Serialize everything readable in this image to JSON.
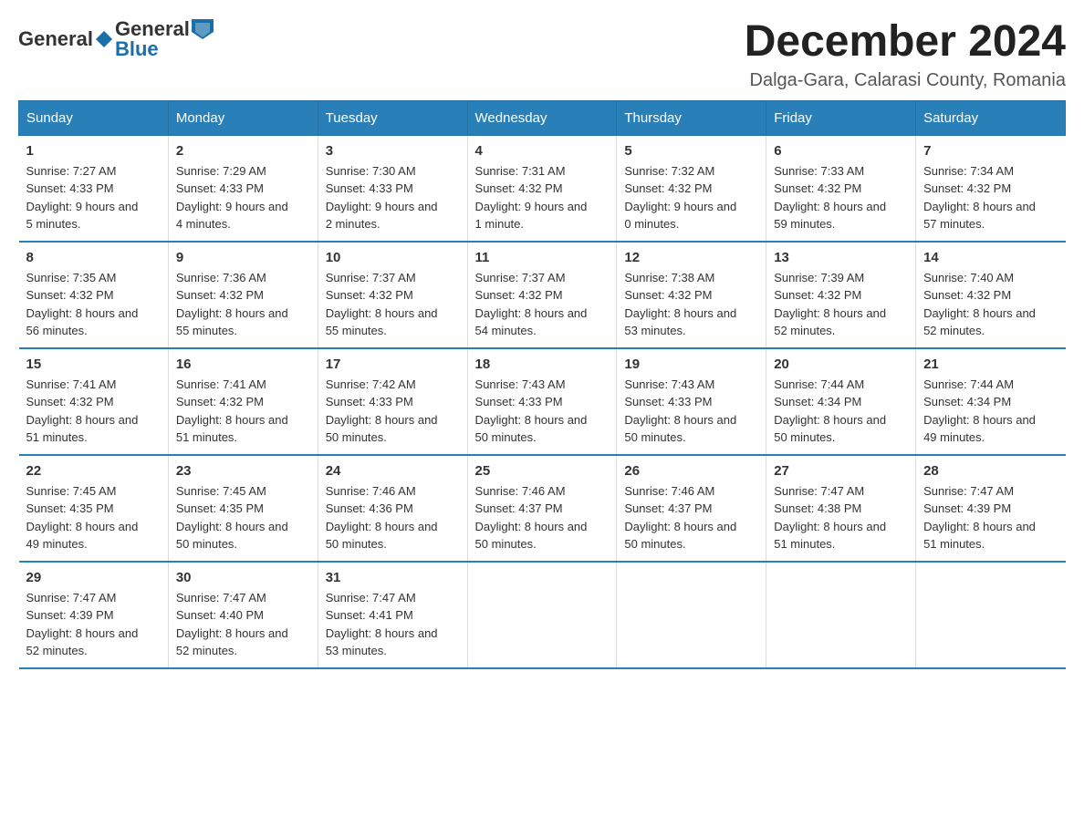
{
  "header": {
    "logo": {
      "general": "General",
      "blue": "Blue"
    },
    "title": "December 2024",
    "location": "Dalga-Gara, Calarasi County, Romania"
  },
  "days_of_week": [
    "Sunday",
    "Monday",
    "Tuesday",
    "Wednesday",
    "Thursday",
    "Friday",
    "Saturday"
  ],
  "weeks": [
    [
      {
        "day": 1,
        "sunrise": "7:27 AM",
        "sunset": "4:33 PM",
        "daylight": "9 hours and 5 minutes."
      },
      {
        "day": 2,
        "sunrise": "7:29 AM",
        "sunset": "4:33 PM",
        "daylight": "9 hours and 4 minutes."
      },
      {
        "day": 3,
        "sunrise": "7:30 AM",
        "sunset": "4:33 PM",
        "daylight": "9 hours and 2 minutes."
      },
      {
        "day": 4,
        "sunrise": "7:31 AM",
        "sunset": "4:32 PM",
        "daylight": "9 hours and 1 minute."
      },
      {
        "day": 5,
        "sunrise": "7:32 AM",
        "sunset": "4:32 PM",
        "daylight": "9 hours and 0 minutes."
      },
      {
        "day": 6,
        "sunrise": "7:33 AM",
        "sunset": "4:32 PM",
        "daylight": "8 hours and 59 minutes."
      },
      {
        "day": 7,
        "sunrise": "7:34 AM",
        "sunset": "4:32 PM",
        "daylight": "8 hours and 57 minutes."
      }
    ],
    [
      {
        "day": 8,
        "sunrise": "7:35 AM",
        "sunset": "4:32 PM",
        "daylight": "8 hours and 56 minutes."
      },
      {
        "day": 9,
        "sunrise": "7:36 AM",
        "sunset": "4:32 PM",
        "daylight": "8 hours and 55 minutes."
      },
      {
        "day": 10,
        "sunrise": "7:37 AM",
        "sunset": "4:32 PM",
        "daylight": "8 hours and 55 minutes."
      },
      {
        "day": 11,
        "sunrise": "7:37 AM",
        "sunset": "4:32 PM",
        "daylight": "8 hours and 54 minutes."
      },
      {
        "day": 12,
        "sunrise": "7:38 AM",
        "sunset": "4:32 PM",
        "daylight": "8 hours and 53 minutes."
      },
      {
        "day": 13,
        "sunrise": "7:39 AM",
        "sunset": "4:32 PM",
        "daylight": "8 hours and 52 minutes."
      },
      {
        "day": 14,
        "sunrise": "7:40 AM",
        "sunset": "4:32 PM",
        "daylight": "8 hours and 52 minutes."
      }
    ],
    [
      {
        "day": 15,
        "sunrise": "7:41 AM",
        "sunset": "4:32 PM",
        "daylight": "8 hours and 51 minutes."
      },
      {
        "day": 16,
        "sunrise": "7:41 AM",
        "sunset": "4:32 PM",
        "daylight": "8 hours and 51 minutes."
      },
      {
        "day": 17,
        "sunrise": "7:42 AM",
        "sunset": "4:33 PM",
        "daylight": "8 hours and 50 minutes."
      },
      {
        "day": 18,
        "sunrise": "7:43 AM",
        "sunset": "4:33 PM",
        "daylight": "8 hours and 50 minutes."
      },
      {
        "day": 19,
        "sunrise": "7:43 AM",
        "sunset": "4:33 PM",
        "daylight": "8 hours and 50 minutes."
      },
      {
        "day": 20,
        "sunrise": "7:44 AM",
        "sunset": "4:34 PM",
        "daylight": "8 hours and 50 minutes."
      },
      {
        "day": 21,
        "sunrise": "7:44 AM",
        "sunset": "4:34 PM",
        "daylight": "8 hours and 49 minutes."
      }
    ],
    [
      {
        "day": 22,
        "sunrise": "7:45 AM",
        "sunset": "4:35 PM",
        "daylight": "8 hours and 49 minutes."
      },
      {
        "day": 23,
        "sunrise": "7:45 AM",
        "sunset": "4:35 PM",
        "daylight": "8 hours and 50 minutes."
      },
      {
        "day": 24,
        "sunrise": "7:46 AM",
        "sunset": "4:36 PM",
        "daylight": "8 hours and 50 minutes."
      },
      {
        "day": 25,
        "sunrise": "7:46 AM",
        "sunset": "4:37 PM",
        "daylight": "8 hours and 50 minutes."
      },
      {
        "day": 26,
        "sunrise": "7:46 AM",
        "sunset": "4:37 PM",
        "daylight": "8 hours and 50 minutes."
      },
      {
        "day": 27,
        "sunrise": "7:47 AM",
        "sunset": "4:38 PM",
        "daylight": "8 hours and 51 minutes."
      },
      {
        "day": 28,
        "sunrise": "7:47 AM",
        "sunset": "4:39 PM",
        "daylight": "8 hours and 51 minutes."
      }
    ],
    [
      {
        "day": 29,
        "sunrise": "7:47 AM",
        "sunset": "4:39 PM",
        "daylight": "8 hours and 52 minutes."
      },
      {
        "day": 30,
        "sunrise": "7:47 AM",
        "sunset": "4:40 PM",
        "daylight": "8 hours and 52 minutes."
      },
      {
        "day": 31,
        "sunrise": "7:47 AM",
        "sunset": "4:41 PM",
        "daylight": "8 hours and 53 minutes."
      },
      null,
      null,
      null,
      null
    ]
  ]
}
